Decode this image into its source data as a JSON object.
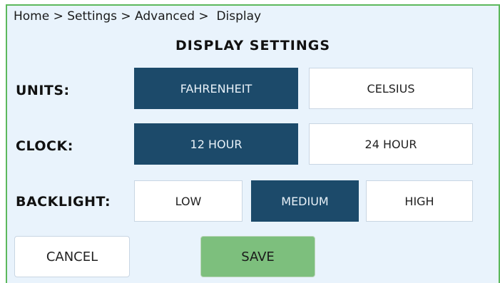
{
  "breadcrumb": "Home > Settings > Advanced >  Display",
  "title": "DISPLAY SETTINGS",
  "units": {
    "label": "UNITS:",
    "options": [
      "FAHRENHEIT",
      "CELSIUS"
    ],
    "selected": "FAHRENHEIT"
  },
  "clock": {
    "label": "CLOCK:",
    "options": [
      "12 HOUR",
      "24 HOUR"
    ],
    "selected": "12 HOUR"
  },
  "backlight": {
    "label": "BACKLIGHT:",
    "options": [
      "LOW",
      "MEDIUM",
      "HIGH"
    ],
    "selected": "MEDIUM"
  },
  "actions": {
    "cancel": "CANCEL",
    "save": "SAVE"
  },
  "colors": {
    "selected": "#1c4a6a",
    "save": "#7dbf7d",
    "panel": "#e9f3fc",
    "frame": "#5cb85c"
  }
}
